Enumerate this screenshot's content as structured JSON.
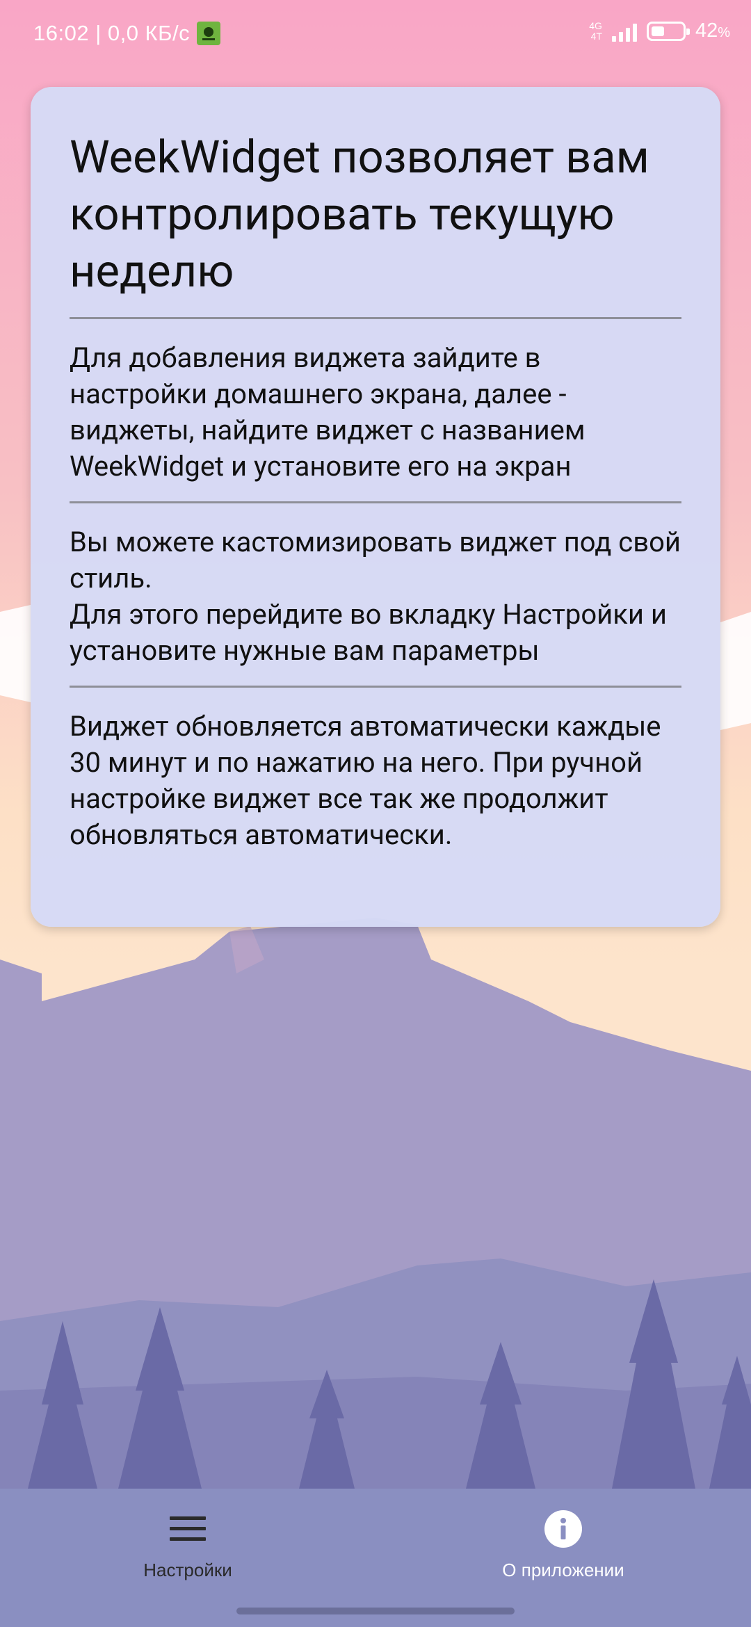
{
  "status_bar": {
    "time_speed": "16:02 | 0,0 КБ/с",
    "network_top": "4G",
    "network_bottom": "4T",
    "battery_percent": "42",
    "battery_unit": "%",
    "battery_level": 0.42
  },
  "card": {
    "title": "WeekWidget позволяет вам контролировать текущую неделю",
    "sections": [
      "Для добавления виджета зайдите в настройки домашнего экрана, далее - виджеты, найдите виджет с названием WeekWidget и установите его на экран",
      "Вы можете кастомизировать виджет под свой стиль.\nДля этого перейдите во вкладку Настройки и установите нужные вам параметры",
      "Виджет обновляется автоматически каждые 30 минут и по нажатию на него. При ручной настройке виджет все так же продолжит обновляться автоматически."
    ]
  },
  "bottom_nav": {
    "items": [
      {
        "label": "Настройки",
        "icon": "menu-icon"
      },
      {
        "label": "О приложении",
        "icon": "info-icon"
      }
    ]
  },
  "colors": {
    "sky_top": "#f9a6c6",
    "mountain": "#a59cc6",
    "card_bg": "#d6daf6",
    "nav_bg": "#8a8fc1"
  }
}
